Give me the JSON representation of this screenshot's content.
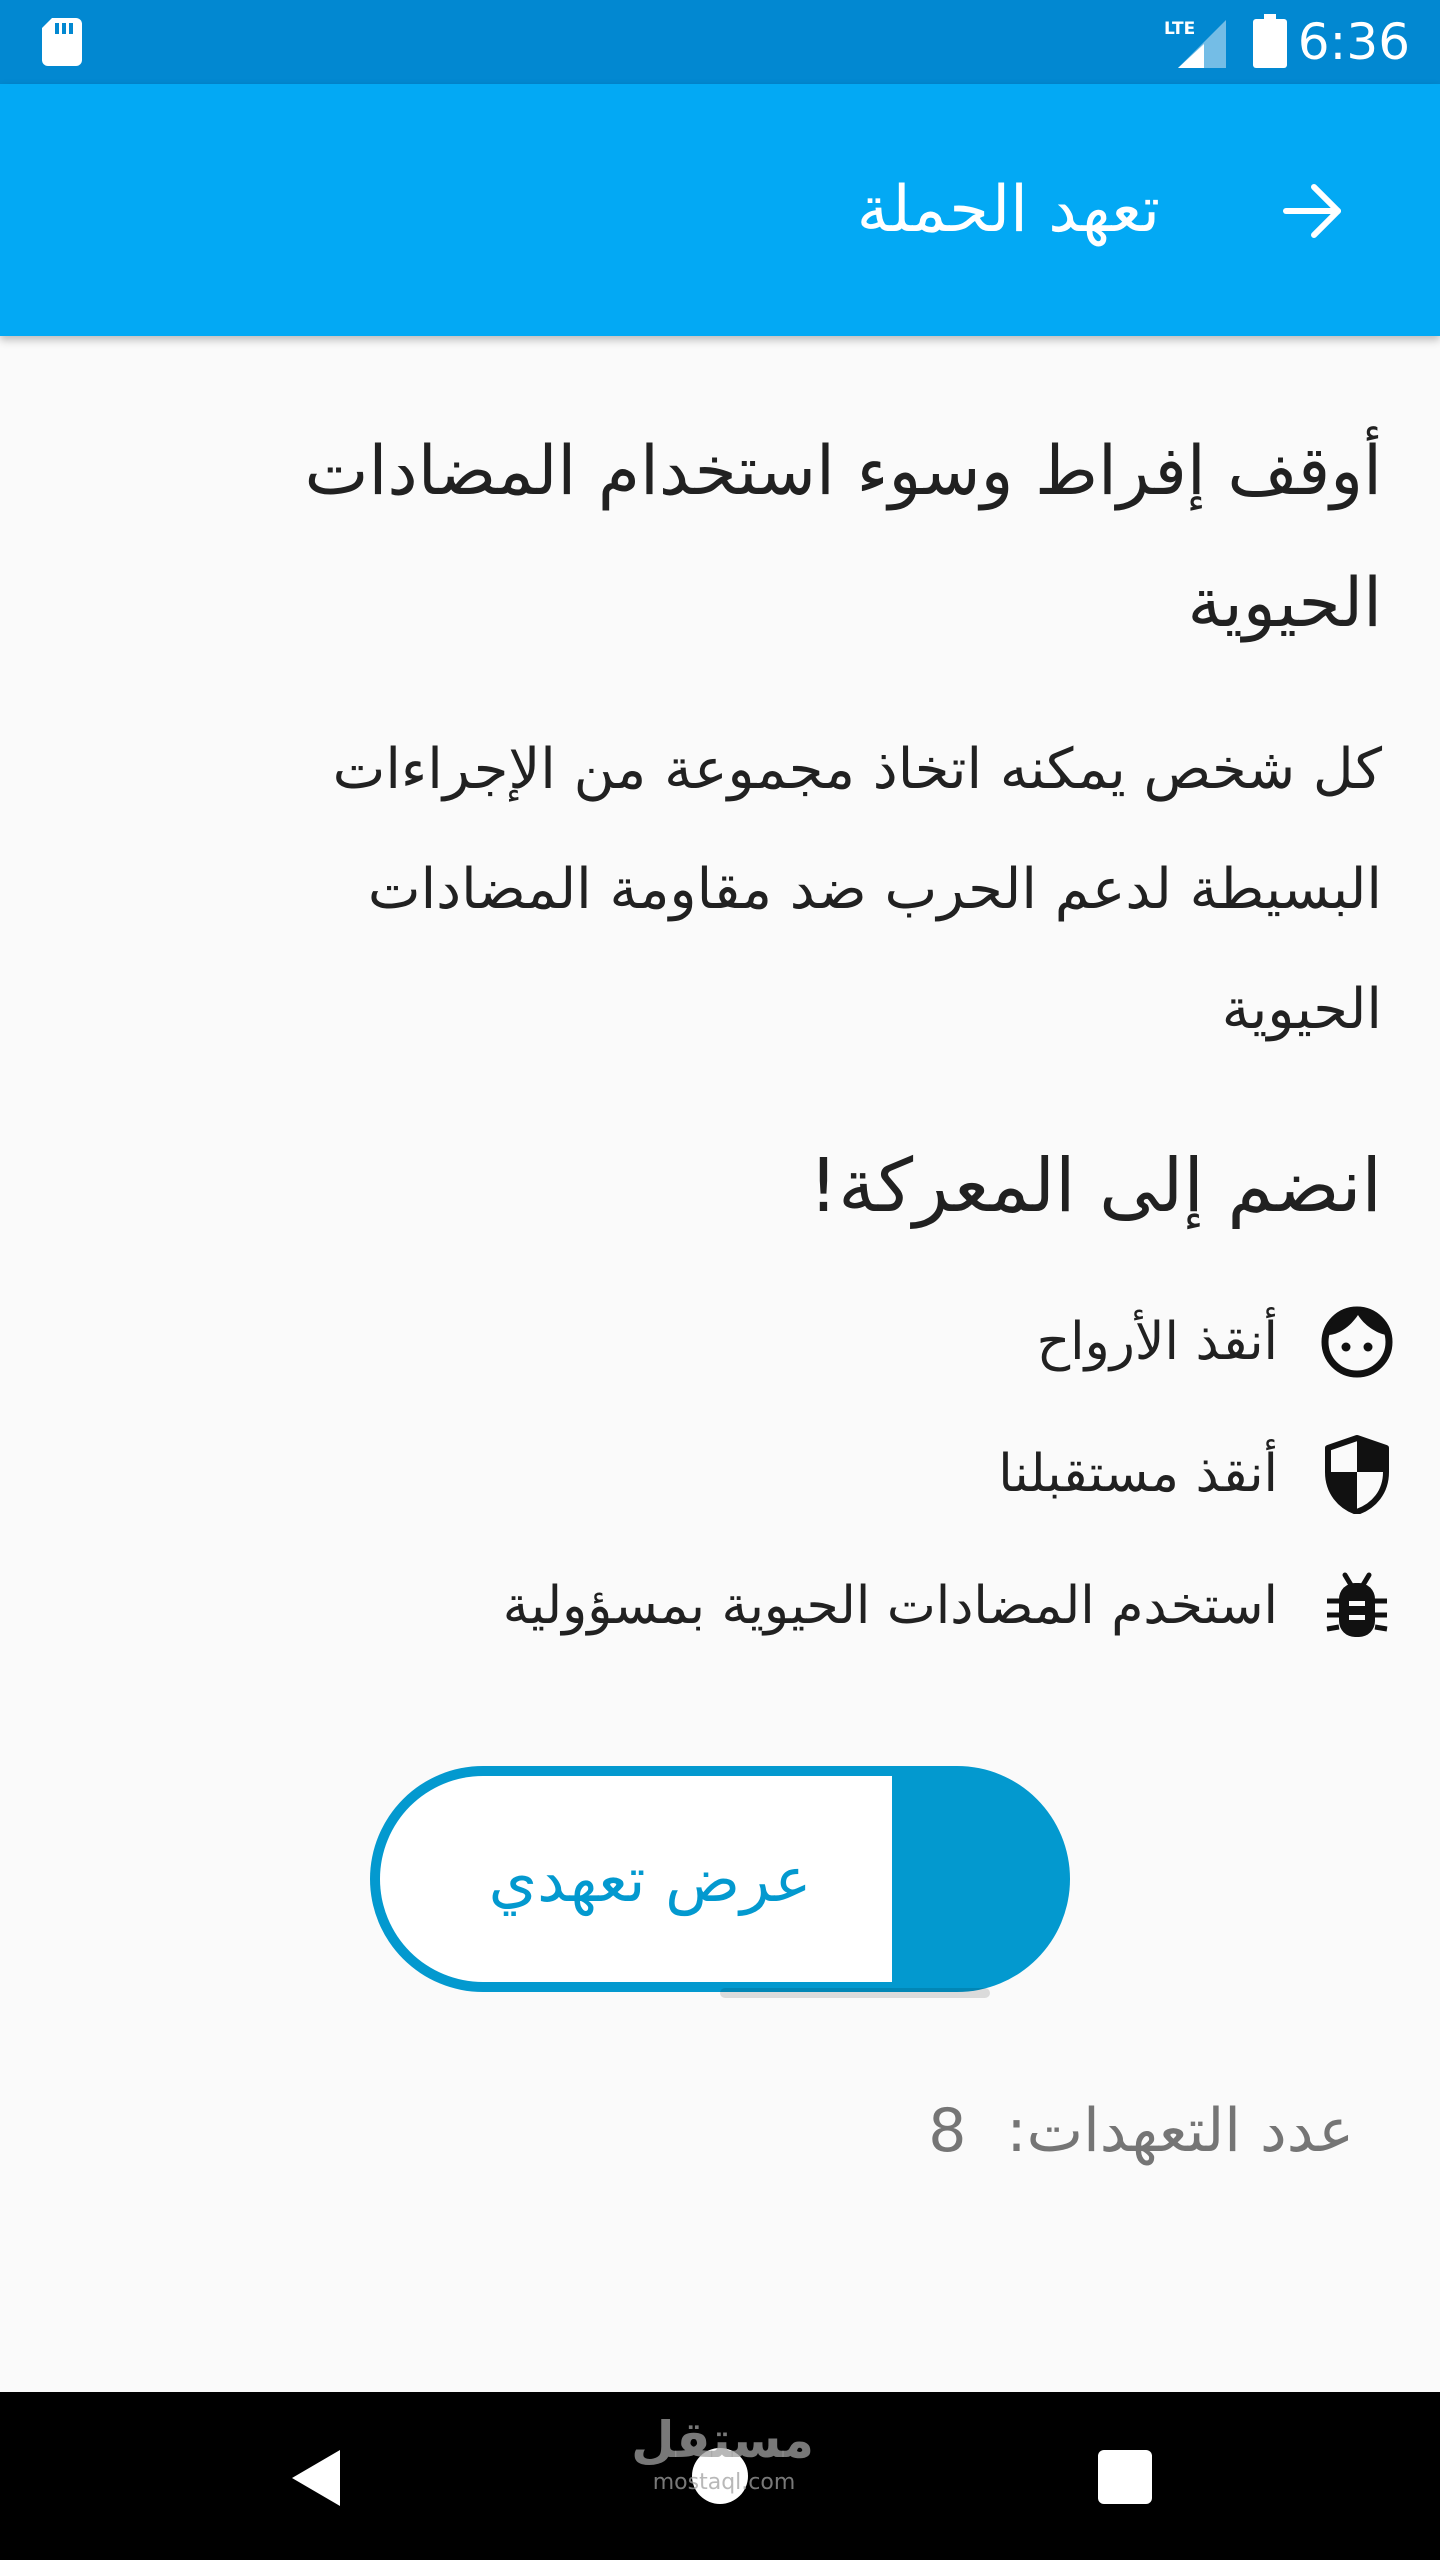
{
  "status_bar": {
    "time": "6:36",
    "network": "LTE",
    "icons": [
      "sd-card-icon",
      "lte-signal-icon",
      "battery-icon"
    ]
  },
  "app_bar": {
    "title": "تعهد الحملة",
    "back_icon": "arrow-right-icon",
    "color": "#03a9f4"
  },
  "content": {
    "headline": "أوقف إفراط وسوء استخدام المضادات الحيوية",
    "body": "كل شخص يمكنه اتخاذ مجموعة من الإجراءات البسيطة لدعم الحرب ضد مقاومة المضادات الحيوية",
    "join_title": "انضم إلى المعركة!",
    "benefits": [
      {
        "icon": "face-icon",
        "label": "أنقذ الأرواح"
      },
      {
        "icon": "shield-icon",
        "label": "أنقذ مستقبلنا"
      },
      {
        "icon": "bug-icon",
        "label": "استخدم المضادات الحيوية بمسؤولية"
      }
    ],
    "pledge_button_label": "عرض تعهدي",
    "pledge_count_label": "عدد التعهدات:",
    "pledge_count_value": "8"
  },
  "nav_bar": {
    "icons": [
      "back-triangle-icon",
      "home-circle-icon",
      "recents-square-icon"
    ]
  },
  "watermark": {
    "arabic": "مستقل",
    "latin": "mostaql.com"
  },
  "colors": {
    "status_bar": "#0288d1",
    "accent": "#0399cf",
    "background": "#fafafa"
  }
}
